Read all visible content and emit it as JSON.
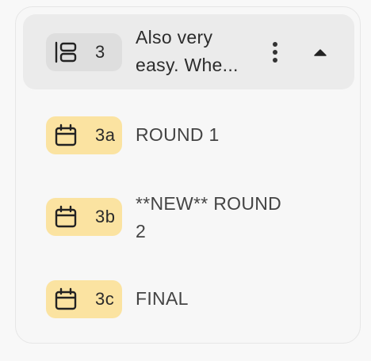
{
  "group": {
    "number": "3",
    "title_line1": "Also very",
    "title_line2": "easy. Whe..."
  },
  "items": [
    {
      "number": "3a",
      "title_line1": "ROUND 1",
      "title_line2": ""
    },
    {
      "number": "3b",
      "title_line1": "**NEW** ROUND",
      "title_line2": "2"
    },
    {
      "number": "3c",
      "title_line1": "FINAL",
      "title_line2": ""
    }
  ],
  "colors": {
    "group_badge": "#dedede",
    "item_badge": "#fbe3a1",
    "header_bg": "#ebebeb"
  },
  "icons": {
    "group": "list-layout-icon",
    "item": "calendar-icon",
    "menu": "more-vertical-icon",
    "toggle": "chevron-up-icon"
  }
}
